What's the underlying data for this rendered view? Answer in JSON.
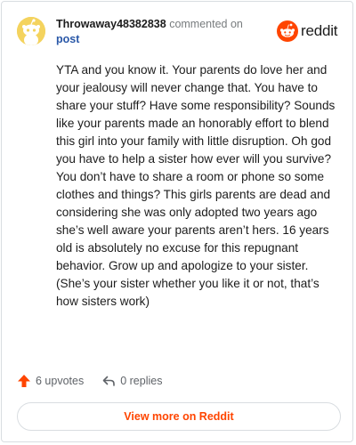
{
  "header": {
    "username": "Throwaway48382838",
    "action_text": "commented on",
    "post_link": "post",
    "avatar_icon": "snoo-avatar-icon",
    "avatar_color": "#f4d35e"
  },
  "logo": {
    "icon": "reddit-snoo-icon",
    "text": "reddit",
    "brand_color": "#ff4500"
  },
  "comment": {
    "body": "YTA and you know it. Your parents do love her and your jealousy will never change that. You have to share your stuff? Have some responsibility? Sounds like your parents made an honorably effort to blend this girl into your family with little disruption. Oh god you have to help a sister how ever will you survive? You don’t have to share a room or phone so some clothes and things? This girls parents are dead and considering she was only adopted two years ago she’s well aware your parents aren’t hers. 16 years old is absolutely no excuse for this repugnant behavior. Grow up and apologize to your sister. (She’s your sister whether you like it or not, that’s how sisters work)"
  },
  "footer": {
    "upvotes_label": "6 upvotes",
    "upvote_icon": "upvote-arrow-icon",
    "upvote_color": "#ff4500",
    "replies_label": "0 replies",
    "reply_icon": "reply-arrow-icon"
  },
  "view_more": {
    "label": "View more on Reddit"
  }
}
